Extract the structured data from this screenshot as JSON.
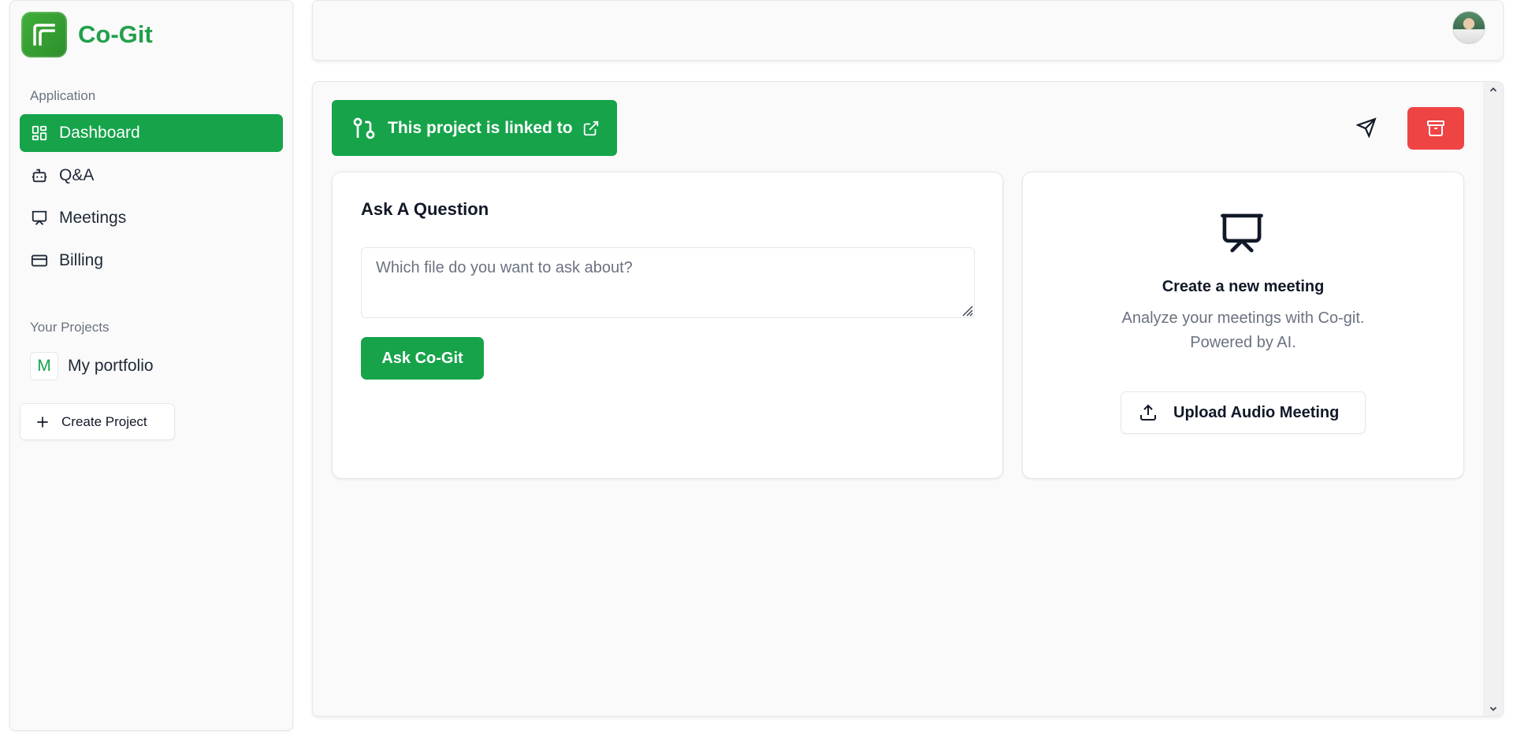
{
  "brand": {
    "name": "Co-Git",
    "logo_icon": "co-git-logo"
  },
  "sidebar": {
    "application_label": "Application",
    "items": [
      {
        "label": "Dashboard",
        "icon": "dashboard-icon",
        "active": true
      },
      {
        "label": "Q&A",
        "icon": "bot-icon",
        "active": false
      },
      {
        "label": "Meetings",
        "icon": "presentation-icon",
        "active": false
      },
      {
        "label": "Billing",
        "icon": "credit-card-icon",
        "active": false
      }
    ],
    "projects_label": "Your Projects",
    "projects": [
      {
        "badge": "M",
        "name": "My portfolio"
      }
    ],
    "create_project_label": "Create Project"
  },
  "topbar": {
    "avatar_icon": "user-avatar"
  },
  "main": {
    "linked_banner_text": "This project is linked to",
    "qa": {
      "title": "Ask A Question",
      "placeholder": "Which file do you want to ask about?",
      "value": "",
      "button_label": "Ask Co-Git"
    },
    "meeting": {
      "title": "Create a new meeting",
      "description_line1": "Analyze your meetings with Co-git.",
      "description_line2": "Powered by AI.",
      "upload_label": "Upload Audio Meeting"
    }
  },
  "colors": {
    "accent": "#16a34a",
    "brand_text": "#22a04b",
    "danger": "#ef4444",
    "muted_text": "#6b7280"
  }
}
